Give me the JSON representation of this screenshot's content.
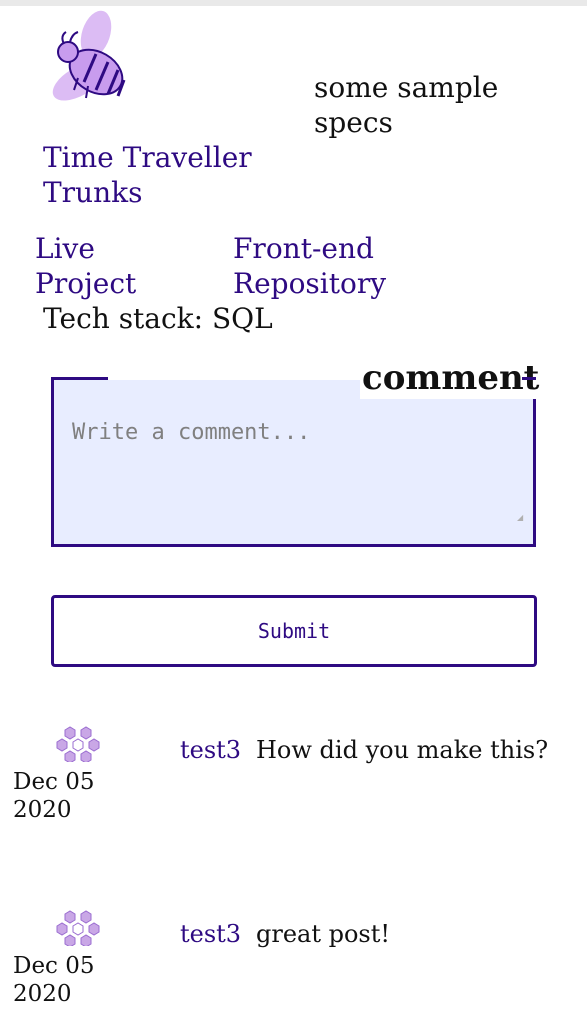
{
  "project": {
    "title": "Time Traveller Trunks",
    "specs": "some sample specs",
    "links": {
      "live": "Live Project",
      "repo": "Front-end Repository"
    },
    "tech_stack": "Tech stack: SQL",
    "logo_icon": "bee-logo-icon"
  },
  "comment_form": {
    "legend": "comment",
    "placeholder": "Write a comment...",
    "submit_label": "Submit"
  },
  "comments": [
    {
      "user": "test3",
      "text": "How did you make this?",
      "date": "Dec 05 2020",
      "avatar_icon": "hexagon-avatar-icon"
    },
    {
      "user": "test3",
      "text": "great post!",
      "date": "Dec 05 2020",
      "avatar_icon": "hexagon-avatar-icon"
    }
  ],
  "colors": {
    "accent": "#2e0a82",
    "logo_fill": "#d9b8f2",
    "textarea_bg": "#e8edff",
    "avatar_fill": "#b48ddc"
  }
}
